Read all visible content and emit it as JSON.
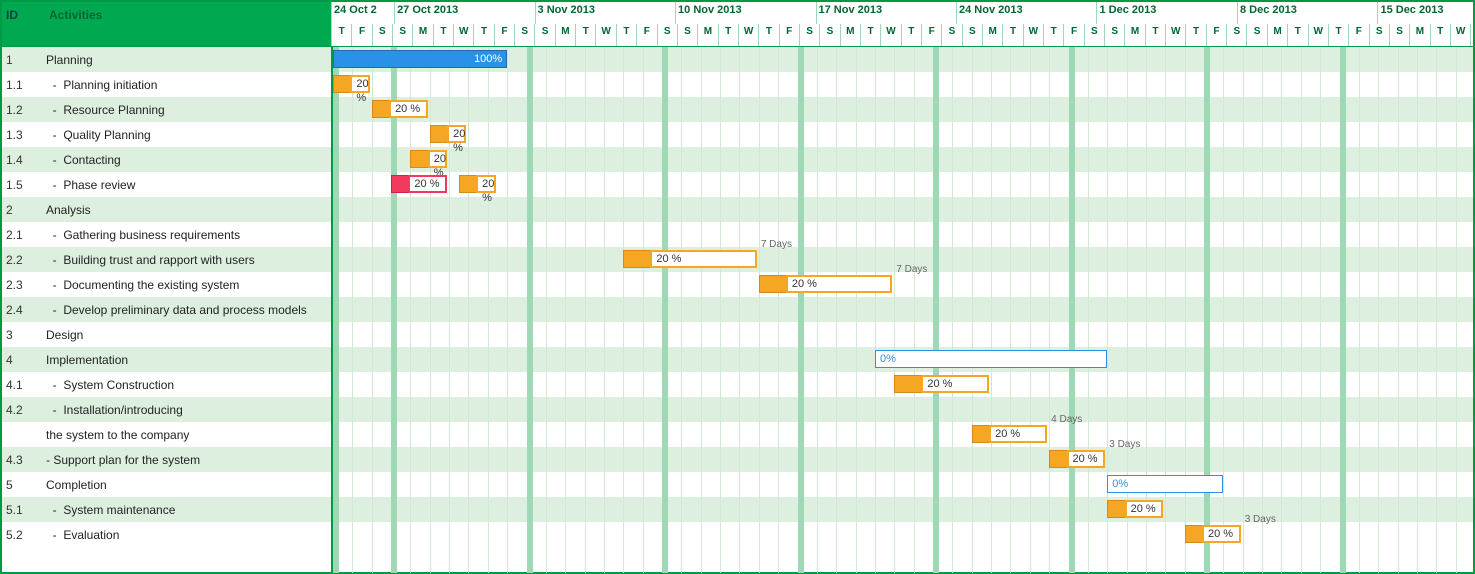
{
  "chart_data": {
    "type": "gantt",
    "title": "",
    "start_date": "2013-10-24",
    "timescale": {
      "first_week_days": [
        "T",
        "F",
        "S"
      ],
      "week_days": [
        "S",
        "M",
        "T",
        "W",
        "T",
        "F",
        "S"
      ],
      "weeks": [
        "24 Oct 2",
        "27 Oct 2013",
        "3 Nov 2013",
        "10 Nov 2013",
        "17 Nov 2013",
        "24 Nov 2013",
        "1 Dec 2013",
        "8 Dec 2013",
        "15 Dec 2013"
      ]
    },
    "columns": [
      "ID",
      "Activities"
    ],
    "rows": [
      {
        "id": "1",
        "activity": "Planning",
        "bar": {
          "type": "summary",
          "start": 0,
          "dur": 9,
          "pct": "100%"
        }
      },
      {
        "id": "1.1",
        "activity": "  -  Planning initiation",
        "bar": {
          "type": "task",
          "start": 0,
          "dur": 2,
          "prog": 1,
          "pct": "20 %"
        }
      },
      {
        "id": "1.2",
        "activity": "  -  Resource Planning",
        "bar": {
          "type": "task",
          "start": 2,
          "dur": 3,
          "prog": 1,
          "pct": "20 %"
        }
      },
      {
        "id": "1.3",
        "activity": "  -  Quality Planning",
        "bar": {
          "type": "task",
          "start": 5,
          "dur": 2,
          "prog": 1,
          "pct": "20 %"
        }
      },
      {
        "id": "1.4",
        "activity": "  -  Contacting",
        "bar": {
          "type": "task",
          "start": 4,
          "dur": 2,
          "prog": 1,
          "pct": "20 %"
        }
      },
      {
        "id": "1.5",
        "activity": "  -  Phase review",
        "bars": [
          {
            "type": "red",
            "start": 3,
            "dur": 3,
            "prog": 1,
            "pct": "20 %"
          },
          {
            "type": "task",
            "start": 6.5,
            "dur": 2,
            "prog": 1,
            "pct": "20 %"
          }
        ]
      },
      {
        "id": "2",
        "activity": "Analysis"
      },
      {
        "id": "2.1",
        "activity": "  -  Gathering business requirements"
      },
      {
        "id": "2.2",
        "activity": "  -  Building trust and rapport with users",
        "bar": {
          "type": "task",
          "start": 15,
          "dur": 7,
          "prog": 1.5,
          "pct": "20 %",
          "label": "7 Days"
        }
      },
      {
        "id": "2.3",
        "activity": "  -  Documenting the existing system",
        "bar": {
          "type": "task",
          "start": 22,
          "dur": 7,
          "prog": 1.5,
          "pct": "20 %",
          "label": "7 Days"
        }
      },
      {
        "id": "2.4",
        "activity": "  -  Develop preliminary data and process models"
      },
      {
        "id": "3",
        "activity": "Design"
      },
      {
        "id": "4",
        "activity": "Implementation",
        "bar": {
          "type": "summary-open",
          "start": 28,
          "dur": 12,
          "pct": "0%"
        }
      },
      {
        "id": "4.1",
        "activity": "  -  System Construction",
        "bar": {
          "type": "task",
          "start": 29,
          "dur": 5,
          "prog": 1.5,
          "pct": "20 %"
        }
      },
      {
        "id": "4.2",
        "activity": "  -  Installation/introducing"
      },
      {
        "id": "",
        "activity": "the system to the company",
        "bar": {
          "type": "task",
          "start": 33,
          "dur": 4,
          "prog": 1,
          "pct": "20 %",
          "label": "4 Days"
        }
      },
      {
        "id": "4.3",
        "activity": " - Support plan for the system",
        "bar": {
          "type": "task",
          "start": 37,
          "dur": 3,
          "prog": 1,
          "pct": "20 %",
          "label": "3 Days"
        }
      },
      {
        "id": "5",
        "activity": "Completion",
        "bar": {
          "type": "summary-open",
          "start": 40,
          "dur": 6,
          "pct": "0%"
        }
      },
      {
        "id": "5.1",
        "activity": "  -  System maintenance",
        "bar": {
          "type": "task",
          "start": 40,
          "dur": 3,
          "prog": 1,
          "pct": "20 %"
        }
      },
      {
        "id": "5.2",
        "activity": "  -  Evaluation",
        "bar": {
          "type": "task",
          "start": 44,
          "dur": 3,
          "prog": 1,
          "pct": "20 %",
          "label": "3 Days"
        }
      }
    ]
  }
}
